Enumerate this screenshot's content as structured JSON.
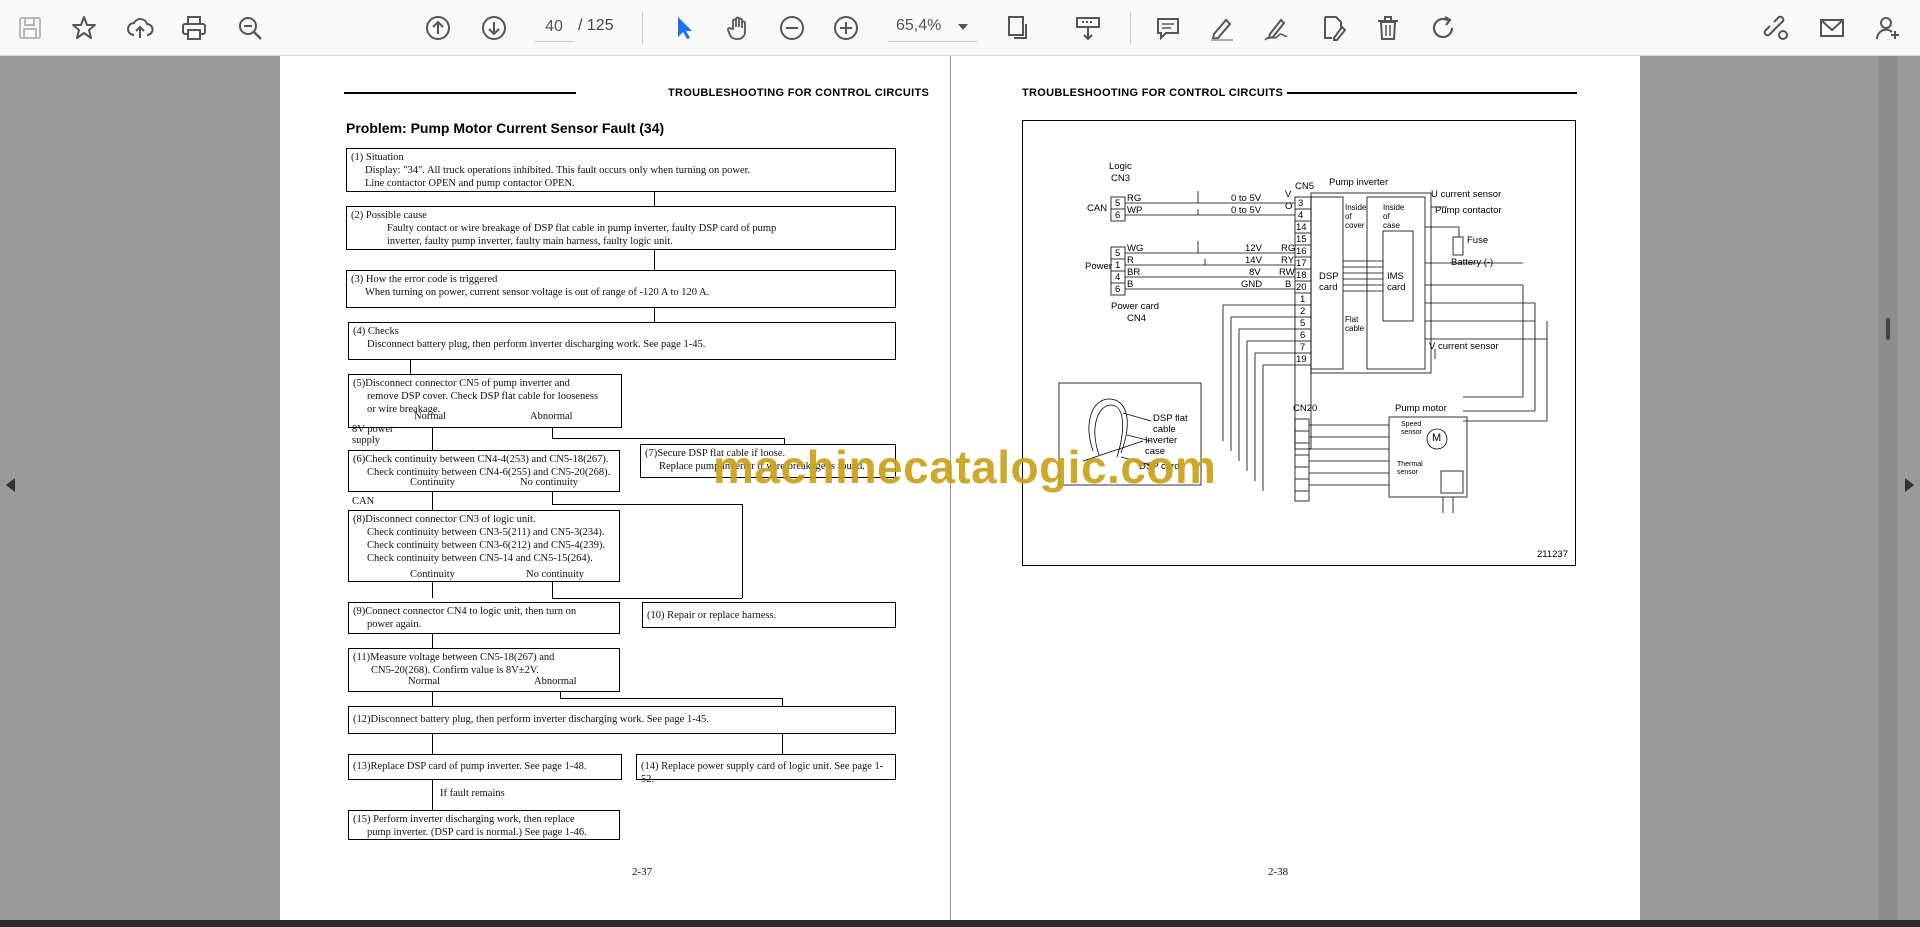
{
  "toolbar": {
    "page_current": "40",
    "page_total": "/  125",
    "zoom": "65,4%",
    "icons": [
      "save-icon",
      "bookmark-star-icon",
      "upload-cloud-icon",
      "print-icon",
      "zoom-search-icon",
      "page-up-icon",
      "page-down-icon",
      "select-cursor-icon",
      "hand-pan-icon",
      "zoom-out-icon",
      "zoom-in-icon",
      "page-fit-icon",
      "extract-page-icon",
      "comment-icon",
      "highlight-pen-icon",
      "sign-pen-icon",
      "edit-doc-icon",
      "delete-icon",
      "redo-icon",
      "share-link-icon",
      "mail-icon",
      "add-user-icon"
    ]
  },
  "left_page": {
    "header": "TROUBLESHOOTING FOR CONTROL CIRCUITS",
    "title": "Problem: Pump Motor Current Sensor Fault (34)",
    "boxes": {
      "b1": [
        "(1) Situation",
        "Display: \"34\". All truck operations inhibited. This fault occurs only when turning on power.",
        "Line contactor OPEN and pump contactor OPEN."
      ],
      "b2": [
        "(2) Possible cause",
        "Faulty contact or wire breakage of DSP flat cable in pump inverter, faulty DSP card of pump",
        "inverter, faulty pump inverter, faulty main harness, faulty logic unit."
      ],
      "b3": [
        "(3) How the error code is triggered",
        "When turning on power, current sensor voltage is out of range of -120 A to 120 A."
      ],
      "b4": [
        "(4) Checks",
        "Disconnect battery plug, then perform inverter discharging work. See page 1-45."
      ],
      "b5": [
        "(5)Disconnect connector CN5 of pump inverter and",
        "remove DSP cover. Check DSP flat cable for looseness",
        "or wire breakage."
      ],
      "b6": [
        "(6)Check continuity between CN4-4(253) and CN5-18(267).",
        "Check continuity between CN4-6(255) and CN5-20(268)."
      ],
      "b7": [
        "(7)Secure DSP flat cable if loose.",
        "Replace pump inverter if wire breakage is found."
      ],
      "b8": [
        "(8)Disconnect connector CN3 of logic unit.",
        "Check continuity between CN3-5(211) and CN5-3(234).",
        "Check continuity between CN3-6(212) and CN5-4(239).",
        "Check continuity between CN5-14 and CN5-15(264)."
      ],
      "b9": [
        "(9)Connect connector CN4 to logic unit, then turn on",
        "power again."
      ],
      "b10": [
        "(10) Repair or replace harness."
      ],
      "b11": [
        "(11)Measure voltage between CN5-18(267) and",
        "CN5-20(268). Confirm value is 8V±2V."
      ],
      "b12": [
        "(12)Disconnect battery plug, then perform inverter discharging work. See page 1-45."
      ],
      "b13": [
        "(13)Replace DSP card of pump inverter. See page 1-48."
      ],
      "b14": [
        "(14) Replace power supply card of logic unit. See page 1-52."
      ],
      "b15": [
        "(15) Perform inverter discharging work, then replace",
        "pump inverter. (DSP card is normal.) See page 1-46."
      ]
    },
    "labels": {
      "normal": "Normal",
      "abnormal": "Abnormal",
      "power8v": "8V power",
      "supply": "supply",
      "continuity": "Continuity",
      "no_continuity": "No continuity",
      "can": "CAN",
      "if_fault": "If fault remains"
    },
    "page_number": "2-37"
  },
  "right_page": {
    "header": "TROUBLESHOOTING FOR CONTROL CIRCUITS",
    "diagram": {
      "logic": "Logic",
      "cn3": "CN3",
      "can": "CAN",
      "power": "Power",
      "power_card": "Power card",
      "cn4": "CN4",
      "cn5": "CN5",
      "pump_inverter": "Pump inverter",
      "u_sensor": "U current sensor",
      "pump_contactor": "Pump contactor",
      "fuse": "Fuse",
      "battery": "Battery (-)",
      "v_sensor": "V current sensor",
      "inside_cover": [
        "Inside",
        "of",
        "cover"
      ],
      "inside_case": [
        "Inside",
        "of",
        "case"
      ],
      "dsp_card": [
        "DSP",
        "card"
      ],
      "ims_card": [
        "IMS",
        "card"
      ],
      "flat_cable": [
        "Flat",
        "cable"
      ],
      "cn20": "CN20",
      "pump_motor": "Pump motor",
      "speed_sensor": [
        "Speed",
        "sensor"
      ],
      "thermal_sensor": [
        "Thermal",
        "sensor"
      ],
      "dsp_flat_cable": [
        "DSP flat",
        "cable"
      ],
      "inverter_case": [
        "Inverter",
        "case"
      ],
      "dsp_card_photo": "DSP card",
      "v0to5a": "0 to 5V",
      "v0to5b": "0 to 5V",
      "v12": "12V",
      "v14": "14V",
      "v8": "8V",
      "gnd": "GND",
      "wire_codes_left": [
        "RG",
        "WP"
      ],
      "wire_codes_power": [
        "WG",
        "R",
        "BR",
        "B"
      ],
      "wire_codes_right": [
        "V",
        "O",
        "RG",
        "RY",
        "RW",
        "B"
      ],
      "cn3_pins": [
        "5",
        "6"
      ],
      "cn4_pins": [
        "5",
        "1",
        "4",
        "6"
      ],
      "cn5_pins": [
        "3",
        "4",
        "14",
        "15",
        "16",
        "17",
        "18",
        "20",
        "1",
        "2",
        "5",
        "6",
        "7",
        "19"
      ],
      "m": "M",
      "code": "211237"
    },
    "page_number": "2-38"
  },
  "watermark": "machinecatalogic.com"
}
